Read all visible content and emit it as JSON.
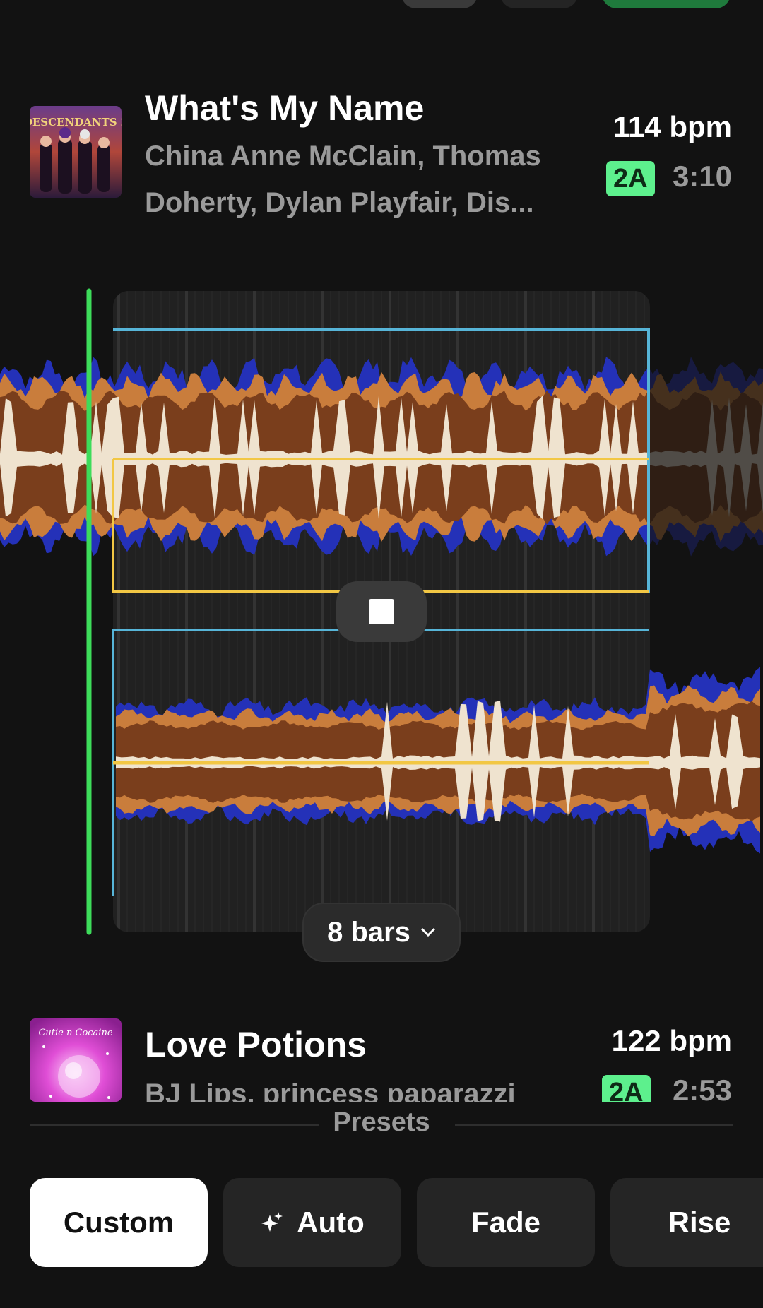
{
  "track_a": {
    "title": "What's My Name",
    "artists_line1": "China Anne McClain, Thomas",
    "artists_line2": "Doherty, Dylan Playfair, Dis...",
    "bpm": "114 bpm",
    "key": "2A",
    "duration": "3:10",
    "art_icon": "album-art-descendants"
  },
  "track_b": {
    "title": "Love Potions",
    "artists": "BJ Lips, princess paparazzi",
    "bpm": "122 bpm",
    "key": "2A",
    "duration": "2:53",
    "art_icon": "album-art-love-potions"
  },
  "transition": {
    "length_label": "8 bars",
    "stop_icon": "stop-icon"
  },
  "presets": {
    "label": "Presets",
    "items": [
      {
        "label": "Custom",
        "active": true
      },
      {
        "label": "Auto",
        "icon": "sparkle-icon"
      },
      {
        "label": "Fade"
      },
      {
        "label": "Rise"
      }
    ]
  },
  "colors": {
    "background": "#121212",
    "key_badge": "#5df08d",
    "playhead": "#3ddc5a",
    "volume_line": "#57b5d8",
    "eq_line": "#f2c744",
    "wave_low": "#7a3e1c",
    "wave_mid": "#c97d3c",
    "wave_high": "#2431b8",
    "wave_peak": "#efe3cf"
  }
}
